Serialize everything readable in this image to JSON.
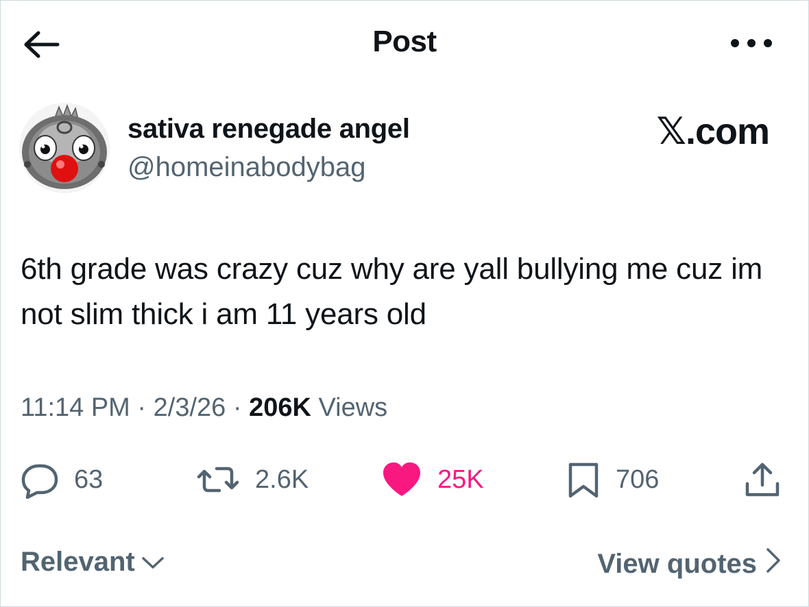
{
  "header": {
    "title": "Post",
    "back_icon": "arrow-left-icon",
    "more_icon": "more-dots-icon"
  },
  "author": {
    "display_name": "sativa renegade angel",
    "handle": "@homeinabodybag",
    "avatar_icon": "clown-avatar"
  },
  "brand": {
    "label": "𝕏.com"
  },
  "tweet": {
    "text": "6th grade was crazy cuz why are yall bullying me cuz im not slim thick i am 11 years old",
    "time": "11:14 PM",
    "date": "2/3/26",
    "separator": " · ",
    "views_count": "206K",
    "views_label": " Views"
  },
  "actions": {
    "replies": "63",
    "reposts": "2.6K",
    "likes": "25K",
    "bookmarks": "706",
    "liked": true
  },
  "footer": {
    "sort_label": "Relevant",
    "view_quotes_label": "View quotes"
  },
  "colors": {
    "text_primary": "#0f1419",
    "text_secondary": "#536471",
    "like_pink": "#f91880",
    "border": "#cfd9de"
  }
}
